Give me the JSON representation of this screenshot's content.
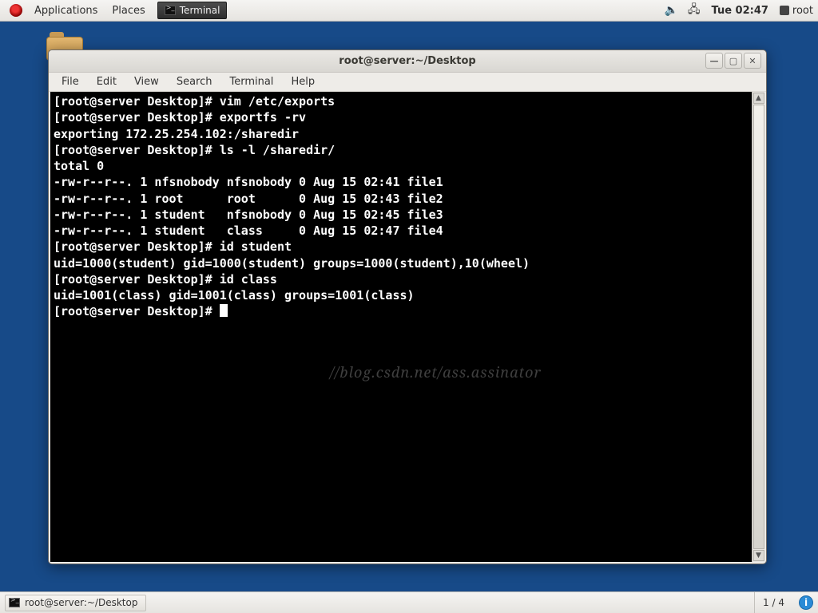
{
  "top_panel": {
    "applications": "Applications",
    "places": "Places",
    "task_terminal": "Terminal",
    "clock": "Tue 02:47",
    "user": "root"
  },
  "window": {
    "title": "root@server:~/Desktop",
    "menubar": [
      "File",
      "Edit",
      "View",
      "Search",
      "Terminal",
      "Help"
    ],
    "win_controls": {
      "min": "—",
      "max": "▢",
      "close": "✕"
    }
  },
  "terminal": {
    "prompt": "[root@server Desktop]# ",
    "lines": [
      "[root@server Desktop]# vim /etc/exports",
      "[root@server Desktop]# exportfs -rv",
      "exporting 172.25.254.102:/sharedir",
      "[root@server Desktop]# ls -l /sharedir/",
      "total 0",
      "-rw-r--r--. 1 nfsnobody nfsnobody 0 Aug 15 02:41 file1",
      "-rw-r--r--. 1 root      root      0 Aug 15 02:43 file2",
      "-rw-r--r--. 1 student   nfsnobody 0 Aug 15 02:45 file3",
      "-rw-r--r--. 1 student   class     0 Aug 15 02:47 file4",
      "[root@server Desktop]# id student",
      "uid=1000(student) gid=1000(student) groups=1000(student),10(wheel)",
      "[root@server Desktop]# id class",
      "uid=1001(class) gid=1001(class) groups=1001(class)",
      ""
    ],
    "commands": {
      "vim": "vim /etc/exports",
      "exportfs": "exportfs -rv",
      "ls": "ls -l /sharedir/",
      "id_student": "id student",
      "id_class": "id class"
    },
    "directory_listing": {
      "path": "/sharedir/",
      "total": 0,
      "files": [
        {
          "perm": "-rw-r--r--.",
          "links": 1,
          "owner": "nfsnobody",
          "group": "nfsnobody",
          "size": 0,
          "date": "Aug 15 02:41",
          "name": "file1"
        },
        {
          "perm": "-rw-r--r--.",
          "links": 1,
          "owner": "root",
          "group": "root",
          "size": 0,
          "date": "Aug 15 02:43",
          "name": "file2"
        },
        {
          "perm": "-rw-r--r--.",
          "links": 1,
          "owner": "student",
          "group": "nfsnobody",
          "size": 0,
          "date": "Aug 15 02:45",
          "name": "file3"
        },
        {
          "perm": "-rw-r--r--.",
          "links": 1,
          "owner": "student",
          "group": "class",
          "size": 0,
          "date": "Aug 15 02:47",
          "name": "file4"
        }
      ]
    },
    "ids": {
      "student": {
        "uid": 1000,
        "gid": 1000,
        "groups": "1000(student),10(wheel)"
      },
      "class": {
        "uid": 1001,
        "gid": 1001,
        "groups": "1001(class)"
      }
    },
    "export_line": "exporting 172.25.254.102:/sharedir"
  },
  "bottom_panel": {
    "task": "root@server:~/Desktop",
    "workspace": "1 / 4"
  },
  "watermark": "//blog.csdn.net/ass.assinator"
}
